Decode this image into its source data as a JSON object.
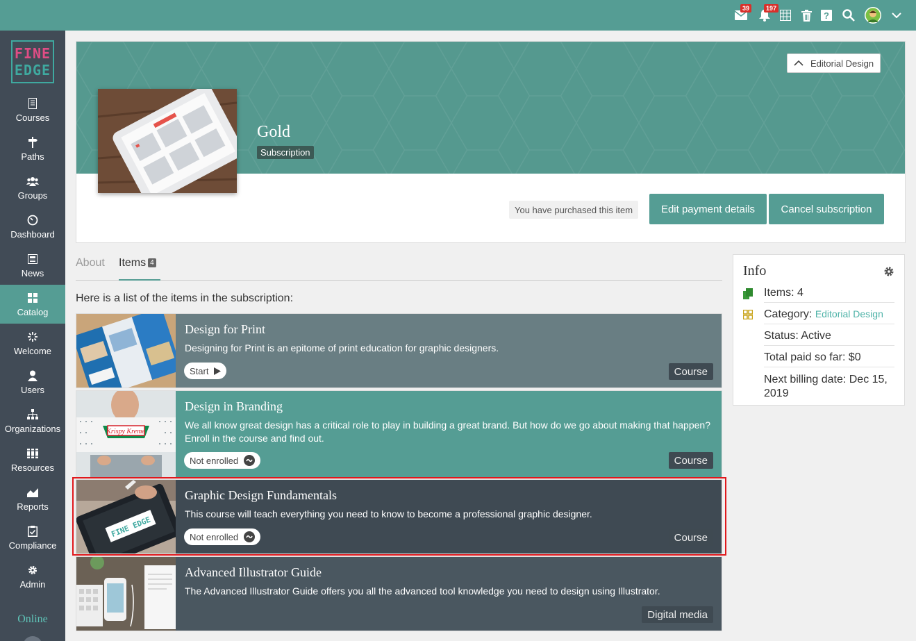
{
  "topbar": {
    "mail_badge": "39",
    "notif_badge": "197"
  },
  "sidebar": {
    "logo_line1": "FINE",
    "logo_line2": "EDGE",
    "items": [
      {
        "label": "Courses",
        "icon": "courses-icon"
      },
      {
        "label": "Paths",
        "icon": "paths-icon"
      },
      {
        "label": "Groups",
        "icon": "groups-icon"
      },
      {
        "label": "Dashboard",
        "icon": "dashboard-icon"
      },
      {
        "label": "News",
        "icon": "news-icon"
      },
      {
        "label": "Catalog",
        "icon": "catalog-icon",
        "active": true
      },
      {
        "label": "Welcome",
        "icon": "welcome-icon"
      },
      {
        "label": "Users",
        "icon": "users-icon"
      },
      {
        "label": "Organizations",
        "icon": "organizations-icon"
      },
      {
        "label": "Resources",
        "icon": "resources-icon"
      },
      {
        "label": "Reports",
        "icon": "reports-icon"
      },
      {
        "label": "Compliance",
        "icon": "compliance-icon"
      },
      {
        "label": "Admin",
        "icon": "admin-icon"
      }
    ],
    "status": "Online"
  },
  "hero": {
    "title": "Gold",
    "type": "Subscription",
    "category_button": "Editorial Design",
    "purchased_text": "You have purchased this item",
    "edit_payment": "Edit payment details",
    "cancel_subscription": "Cancel subscription"
  },
  "tabs": {
    "about": "About",
    "items": "Items",
    "items_count": "4"
  },
  "intro": "Here is a list of the items in the subscription:",
  "items": [
    {
      "title": "Design for Print",
      "desc": "Designing for Print is an epitome of print education for graphic designers.",
      "button": "Start",
      "type": "Course"
    },
    {
      "title": "Design in Branding",
      "desc": "We all know great design has a critical role to play in building a great brand. But how do we go about making that happen? Enroll in the course and find out.",
      "button": "Not enrolled",
      "type": "Course",
      "image_text": "Krispy Kreme"
    },
    {
      "title": "Graphic Design Fundamentals",
      "desc": "This course will teach everything you need to know to become a professional graphic designer.",
      "button": "Not enrolled",
      "type": "Course",
      "image_text": "FINE EDGE"
    },
    {
      "title": "Advanced Illustrator Guide",
      "desc": "The Advanced Illustrator Guide offers you all the advanced tool knowledge you need to design using Illustrator.",
      "type": "Digital media"
    }
  ],
  "info": {
    "title": "Info",
    "items_label": "Items: 4",
    "category_label": "Category: ",
    "category_value": "Editorial Design",
    "status": "Status: Active",
    "total_paid": "Total paid so far: $0",
    "next_billing": "Next billing date: Dec 15, 2019"
  },
  "colors": {
    "brand_teal": "#559d94",
    "sidebar_bg": "#414b56",
    "highlight": "#e0181c"
  }
}
